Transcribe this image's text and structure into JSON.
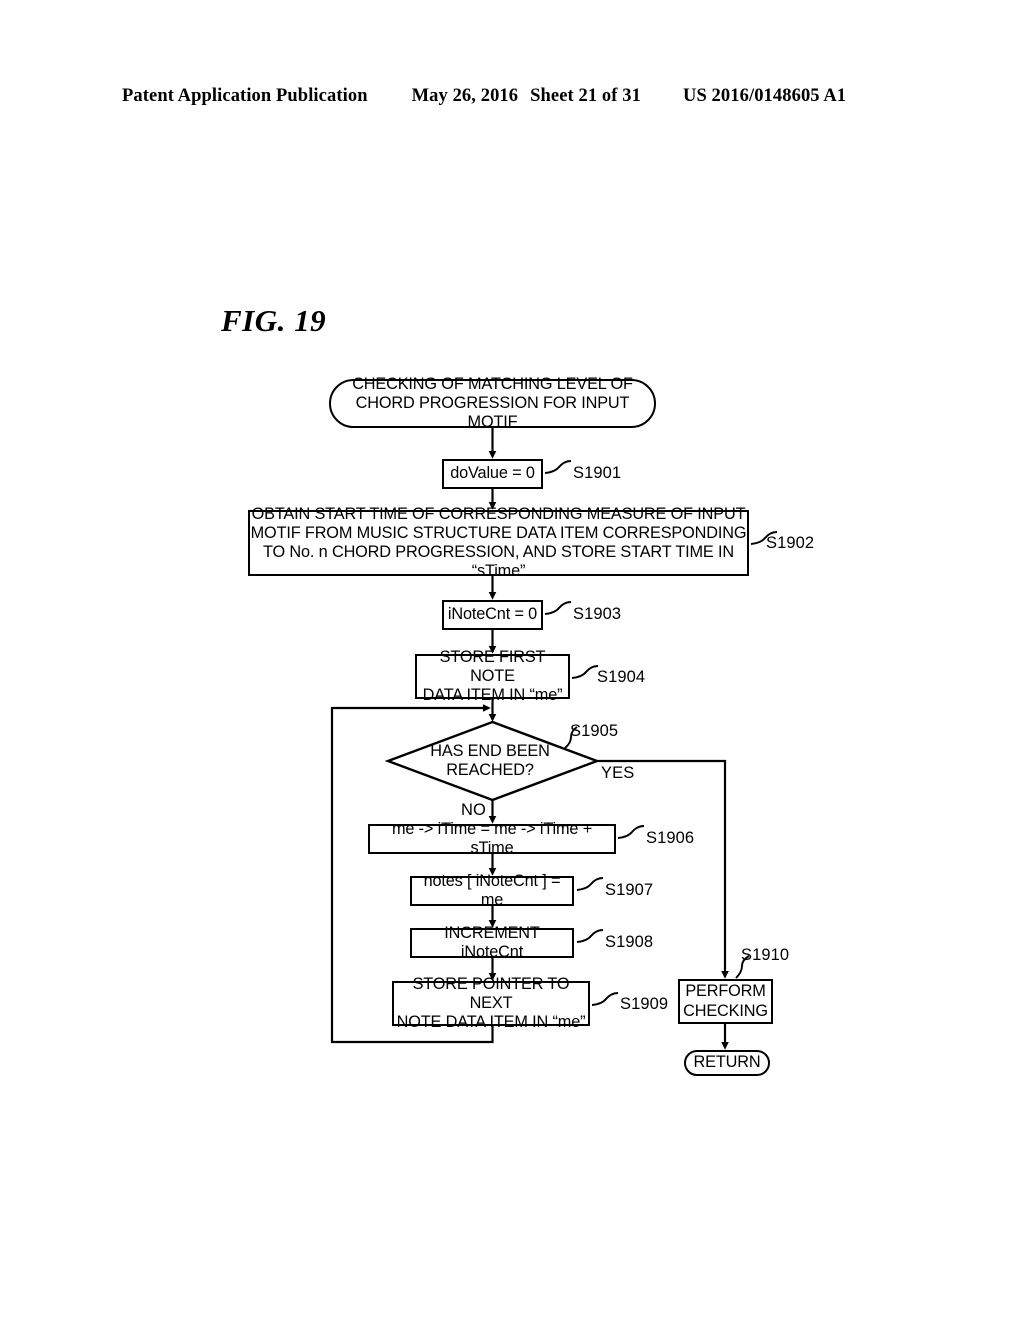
{
  "header": {
    "publication": "Patent Application Publication",
    "date": "May 26, 2016",
    "sheet": "Sheet 21 of 31",
    "patent_number": "US 2016/0148605 A1"
  },
  "figure": {
    "caption": "FIG. 19"
  },
  "chart_data": {
    "type": "diagram",
    "diagram_type": "flowchart",
    "title": "FIG. 19",
    "nodes": [
      {
        "id": "start",
        "shape": "terminal",
        "text": "CHECKING OF MATCHING LEVEL OF CHORD PROGRESSION FOR INPUT MOTIF",
        "step": ""
      },
      {
        "id": "s1901",
        "shape": "process",
        "text": "doValue = 0",
        "step": "S1901"
      },
      {
        "id": "s1902",
        "shape": "process",
        "text": "OBTAIN START TIME OF CORRESPONDING MEASURE OF INPUT MOTIF FROM MUSIC STRUCTURE DATA ITEM CORRESPONDING TO No. n CHORD PROGRESSION, AND STORE START TIME IN “sTime”",
        "step": "S1902"
      },
      {
        "id": "s1903",
        "shape": "process",
        "text": "iNoteCnt = 0",
        "step": "S1903"
      },
      {
        "id": "s1904",
        "shape": "process",
        "text": "STORE FIRST NOTE DATA ITEM IN “me”",
        "step": "S1904"
      },
      {
        "id": "s1905",
        "shape": "decision",
        "text": "HAS END BEEN REACHED?",
        "step": "S1905"
      },
      {
        "id": "s1906",
        "shape": "process",
        "text": "me -> iTime = me -> iTime + sTime",
        "step": "S1906"
      },
      {
        "id": "s1907",
        "shape": "process",
        "text": "notes [ iNoteCnt ] = me",
        "step": "S1907"
      },
      {
        "id": "s1908",
        "shape": "process",
        "text": "INCREMENT iNoteCnt",
        "step": "S1908"
      },
      {
        "id": "s1909",
        "shape": "process",
        "text": "STORE POINTER TO NEXT NOTE DATA ITEM IN “me”",
        "step": "S1909"
      },
      {
        "id": "s1910",
        "shape": "process",
        "text": "PERFORM CHECKING",
        "step": "S1910"
      },
      {
        "id": "return",
        "shape": "terminal",
        "text": "RETURN",
        "step": ""
      }
    ],
    "edges": [
      {
        "from": "start",
        "to": "s1901",
        "label": ""
      },
      {
        "from": "s1901",
        "to": "s1902",
        "label": ""
      },
      {
        "from": "s1902",
        "to": "s1903",
        "label": ""
      },
      {
        "from": "s1903",
        "to": "s1904",
        "label": ""
      },
      {
        "from": "s1904",
        "to": "s1905",
        "label": ""
      },
      {
        "from": "s1905",
        "to": "s1906",
        "label": "NO"
      },
      {
        "from": "s1905",
        "to": "s1910",
        "label": "YES"
      },
      {
        "from": "s1906",
        "to": "s1907",
        "label": ""
      },
      {
        "from": "s1907",
        "to": "s1908",
        "label": ""
      },
      {
        "from": "s1908",
        "to": "s1909",
        "label": ""
      },
      {
        "from": "s1909",
        "to": "s1905",
        "label": ""
      },
      {
        "from": "s1910",
        "to": "return",
        "label": ""
      }
    ]
  },
  "nodes": {
    "start": {
      "line1": "CHECKING OF MATCHING LEVEL OF",
      "line2": "CHORD PROGRESSION FOR INPUT MOTIF"
    },
    "s1901": {
      "text": "doValue = 0",
      "step": "S1901"
    },
    "s1902": {
      "line1": "OBTAIN START TIME OF CORRESPONDING MEASURE OF INPUT",
      "line2": "MOTIF FROM MUSIC STRUCTURE DATA ITEM CORRESPONDING",
      "line3": "TO No. n CHORD PROGRESSION, AND STORE START TIME IN “sTime”",
      "step": "S1902"
    },
    "s1903": {
      "text": "iNoteCnt = 0",
      "step": "S1903"
    },
    "s1904": {
      "line1": "STORE FIRST NOTE",
      "line2": "DATA ITEM IN “me”",
      "step": "S1904"
    },
    "s1905": {
      "line1": "HAS END BEEN",
      "line2": "REACHED?",
      "step": "S1905",
      "yes": "YES",
      "no": "NO"
    },
    "s1906": {
      "text": "me -> iTime = me -> iTime + sTime",
      "step": "S1906"
    },
    "s1907": {
      "text": "notes [ iNoteCnt ] = me",
      "step": "S1907"
    },
    "s1908": {
      "text": "INCREMENT iNoteCnt",
      "step": "S1908"
    },
    "s1909": {
      "line1": "STORE POINTER TO NEXT",
      "line2": "NOTE DATA ITEM IN “me”",
      "step": "S1909"
    },
    "s1910": {
      "line1": "PERFORM",
      "line2": "CHECKING",
      "step": "S1910"
    },
    "return": {
      "text": "RETURN"
    }
  },
  "colors": {
    "ink": "#000000",
    "paper": "#ffffff"
  }
}
